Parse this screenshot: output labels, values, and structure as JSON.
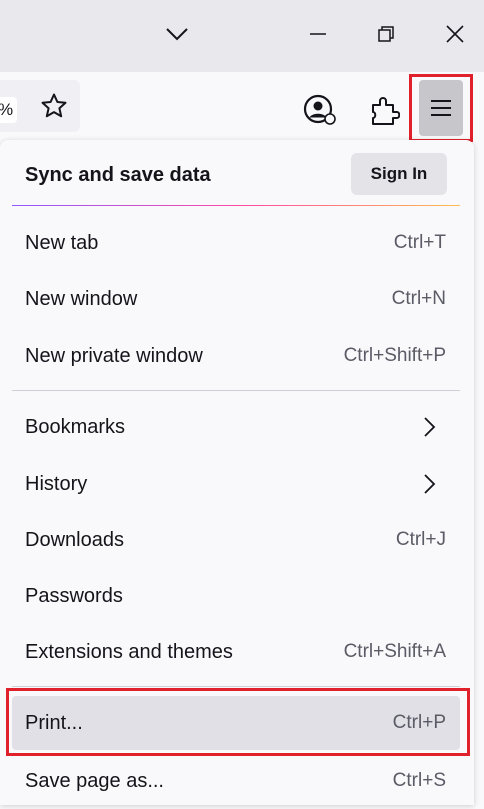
{
  "titlebar": {
    "tabs_dropdown_icon": "chevron-down-icon",
    "minimize_icon": "minimize-icon",
    "restore_icon": "restore-icon",
    "close_icon": "close-icon"
  },
  "navbar": {
    "zoom_text": "%",
    "bookmark_icon": "star-icon",
    "account_icon": "account-icon",
    "extensions_icon": "puzzle-icon",
    "menu_icon": "hamburger-menu-icon"
  },
  "menu": {
    "sync_title": "Sync and save data",
    "sign_in_label": "Sign In",
    "items": [
      {
        "label": "New tab",
        "shortcut": "Ctrl+T"
      },
      {
        "label": "New window",
        "shortcut": "Ctrl+N"
      },
      {
        "label": "New private window",
        "shortcut": "Ctrl+Shift+P"
      },
      {
        "label": "Bookmarks",
        "shortcut": "",
        "submenu": true
      },
      {
        "label": "History",
        "shortcut": "",
        "submenu": true
      },
      {
        "label": "Downloads",
        "shortcut": "Ctrl+J"
      },
      {
        "label": "Passwords",
        "shortcut": ""
      },
      {
        "label": "Extensions and themes",
        "shortcut": "Ctrl+Shift+A"
      },
      {
        "label": "Print...",
        "shortcut": "Ctrl+P",
        "hovered": true
      },
      {
        "label": "Save page as...",
        "shortcut": "Ctrl+S"
      }
    ]
  },
  "colors": {
    "highlight": "#e0202a",
    "menu_button_active": "#c7c7cb",
    "hover_row": "#e0e0e6"
  }
}
